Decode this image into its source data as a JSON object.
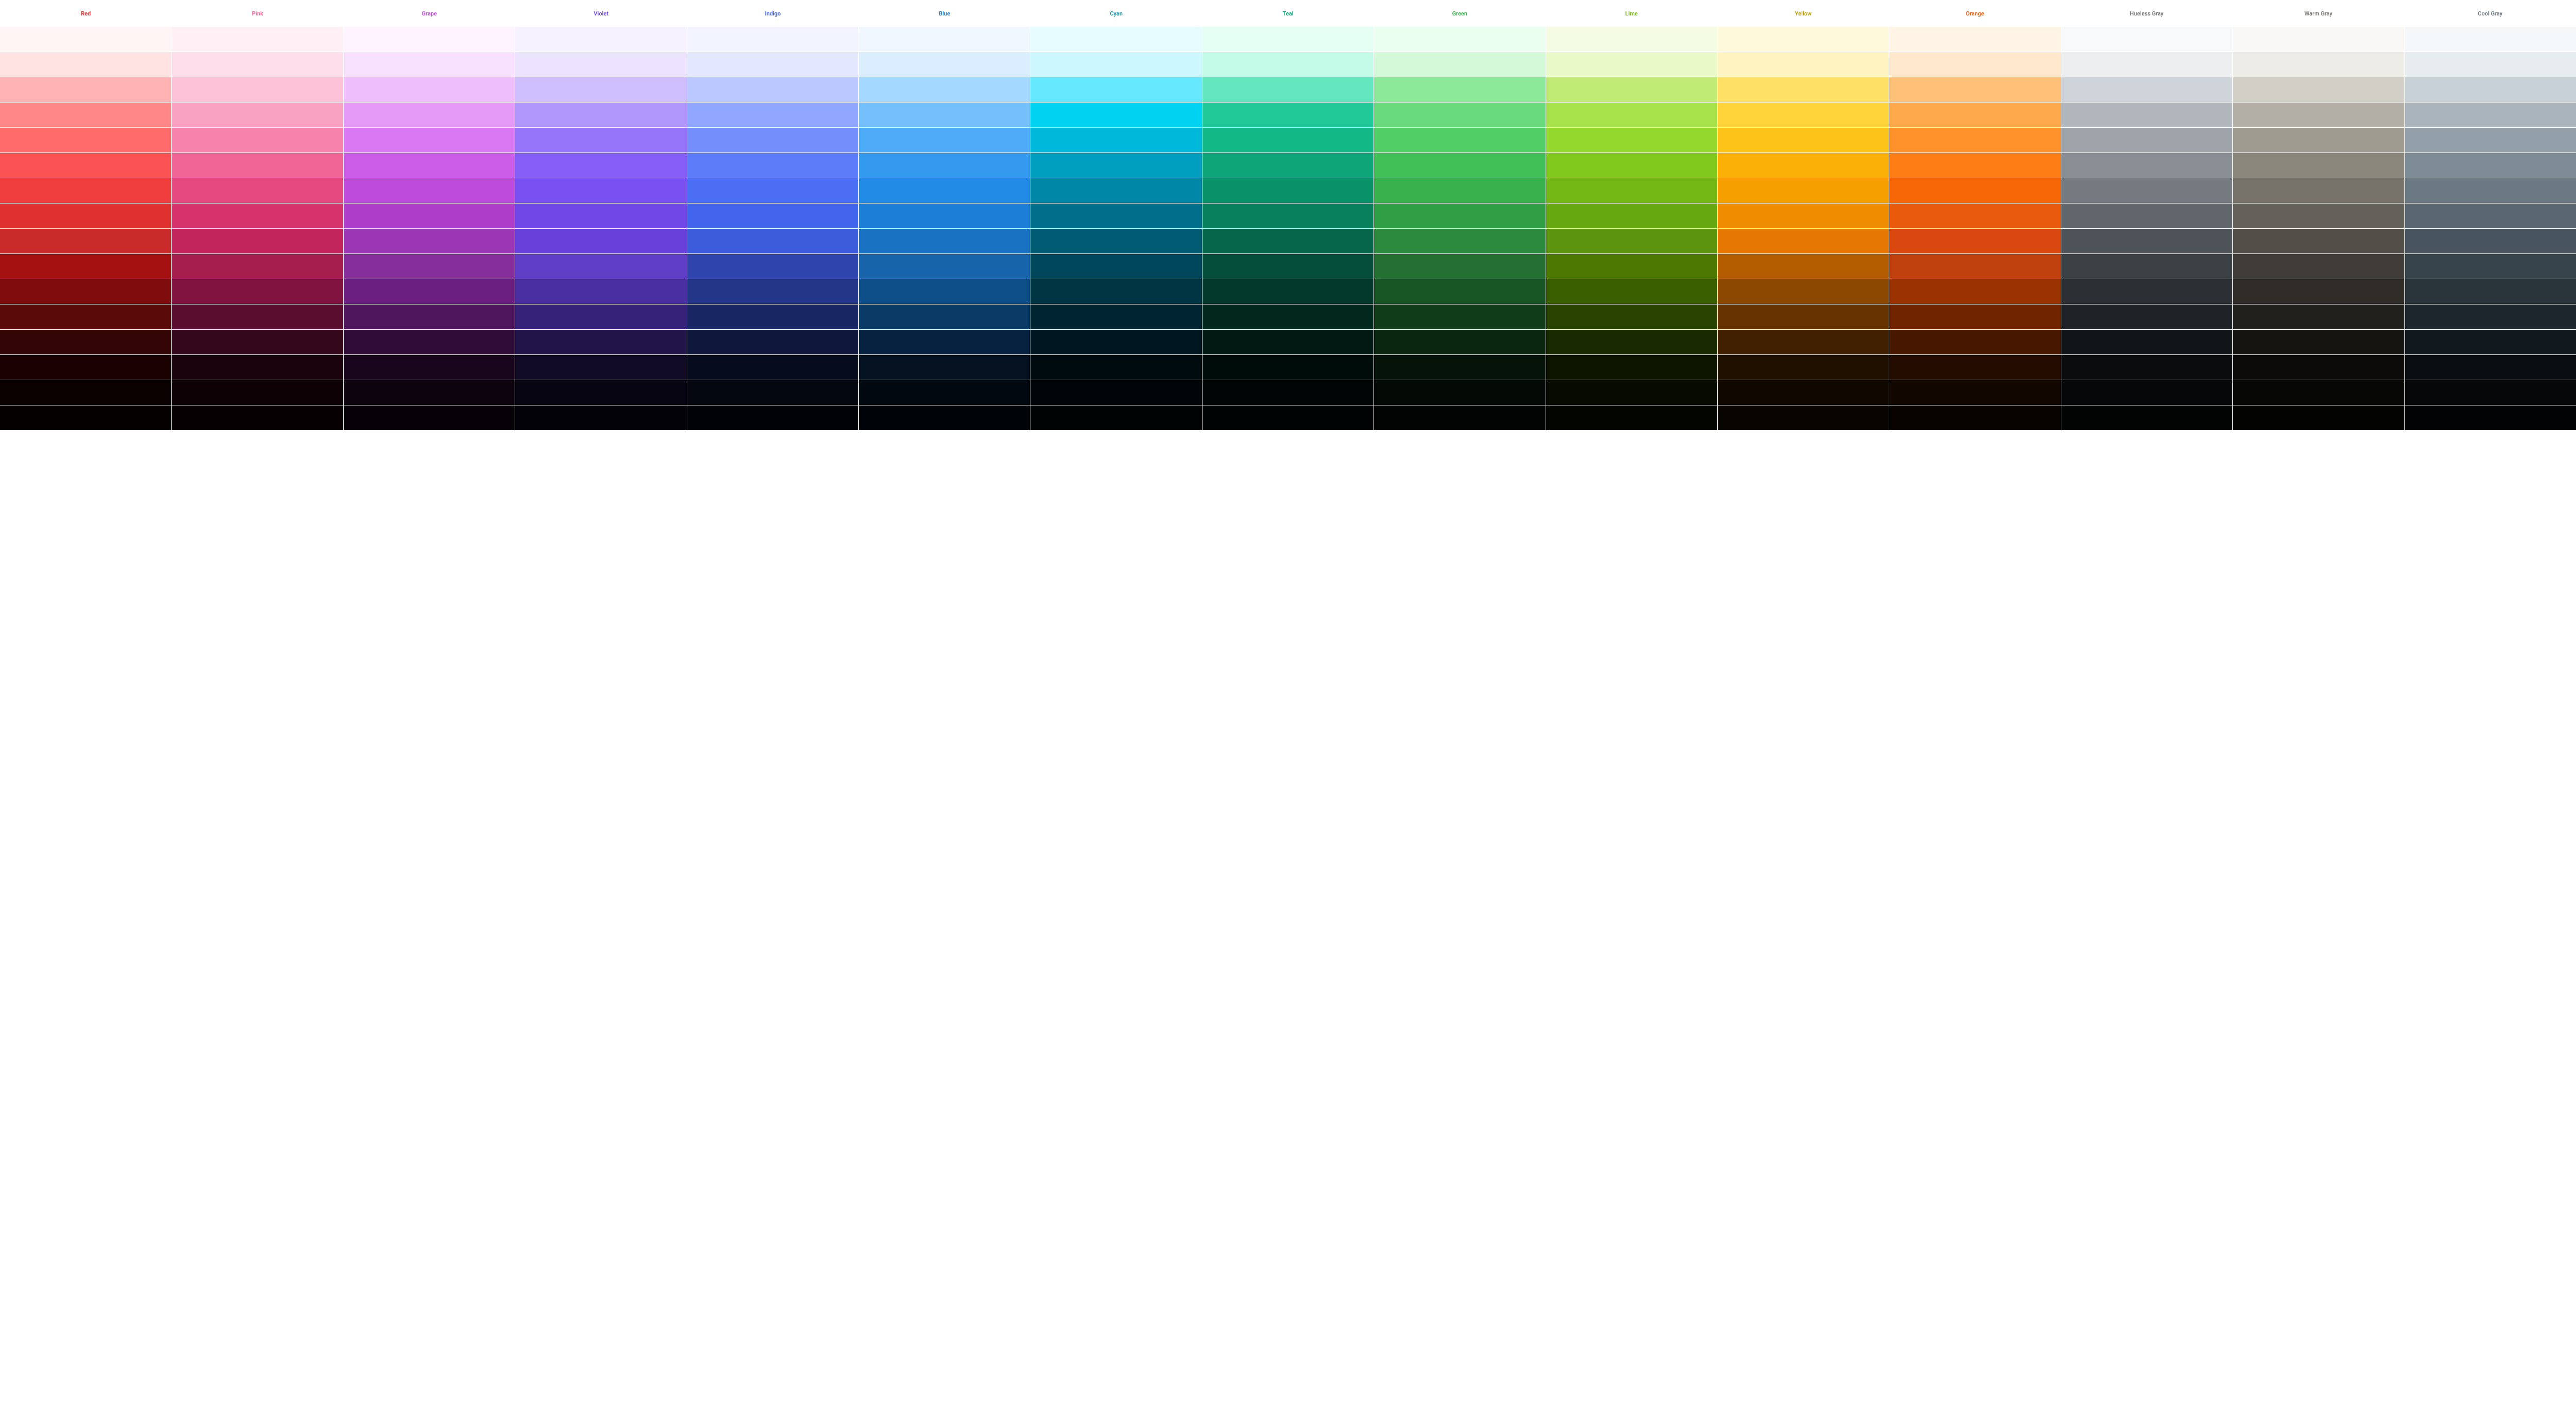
{
  "palette": {
    "columns": [
      {
        "name": "Red",
        "labelColor": "#e03131"
      },
      {
        "name": "Pink",
        "labelColor": "#f06595"
      },
      {
        "name": "Grape",
        "labelColor": "#be4bdb"
      },
      {
        "name": "Violet",
        "labelColor": "#7048e8"
      },
      {
        "name": "Indigo",
        "labelColor": "#4263eb"
      },
      {
        "name": "Blue",
        "labelColor": "#1c7ed6"
      },
      {
        "name": "Cyan",
        "labelColor": "#1098ad"
      },
      {
        "name": "Teal",
        "labelColor": "#0ca678"
      },
      {
        "name": "Green",
        "labelColor": "#37b24d"
      },
      {
        "name": "Lime",
        "labelColor": "#74b816"
      },
      {
        "name": "Yellow",
        "labelColor": "#c29c00"
      },
      {
        "name": "Orange",
        "labelColor": "#e8590c"
      },
      {
        "name": "Hueless Gray",
        "labelColor": "#777777"
      },
      {
        "name": "Warm Gray",
        "labelColor": "#7a7770"
      },
      {
        "name": "Cool Gray",
        "labelColor": "#6f7a82"
      }
    ],
    "shades": [
      [
        "#fff5f5",
        "#fff0f6",
        "#fdf4ff",
        "#f7f2ff",
        "#f2f4ff",
        "#f0f7ff",
        "#e6fcff",
        "#e6fff5",
        "#ebfff0",
        "#f4fce3",
        "#fff9db",
        "#fff4e6",
        "#f8f9fa",
        "#f9f8f6",
        "#f5f8fa"
      ],
      [
        "#ffe3e3",
        "#ffdeeb",
        "#f8e1ff",
        "#ece4ff",
        "#e4e8ff",
        "#dbeeff",
        "#ccf7ff",
        "#c3fae8",
        "#d3f9d8",
        "#e9fac8",
        "#fff3bf",
        "#ffe8cc",
        "#eceeef",
        "#eeece7",
        "#e7ecef"
      ],
      [
        "#ffb3b3",
        "#fcc2d7",
        "#eebefa",
        "#d0bfff",
        "#bac8ff",
        "#a5d8ff",
        "#66e8ff",
        "#63e6be",
        "#8ce99a",
        "#c0eb75",
        "#ffe066",
        "#ffc078",
        "#ced4da",
        "#d2cfc7",
        "#c8d1d8"
      ],
      [
        "#ff8787",
        "#faa2c1",
        "#e599f7",
        "#b197fc",
        "#91a7ff",
        "#74c0fc",
        "#00d3f2",
        "#20c997",
        "#69db7c",
        "#a9e34b",
        "#ffd43b",
        "#ffa94d",
        "#b0b6bb",
        "#b3afa6",
        "#a9b4bc"
      ],
      [
        "#ff6b6b",
        "#f783ac",
        "#da77f2",
        "#9775fa",
        "#748ffc",
        "#4dabf7",
        "#00b8d9",
        "#12b886",
        "#51cf66",
        "#94d82d",
        "#fcc419",
        "#ff922b",
        "#9ea4a9",
        "#9f9b91",
        "#93a0a9"
      ],
      [
        "#fa5252",
        "#f06595",
        "#cc5de8",
        "#845ef7",
        "#5c7cfa",
        "#339af0",
        "#009ebf",
        "#0ca678",
        "#40c057",
        "#82c91e",
        "#fab005",
        "#fd7e14",
        "#888e94",
        "#8b877d",
        "#7e8c96"
      ],
      [
        "#f03e3e",
        "#e64980",
        "#be4bdb",
        "#7950f2",
        "#4c6ef5",
        "#228be6",
        "#0086a6",
        "#099268",
        "#37b24d",
        "#74b816",
        "#f59f00",
        "#f76707",
        "#747a80",
        "#77736a",
        "#6b7983"
      ],
      [
        "#e03131",
        "#d6336c",
        "#ae3ec9",
        "#7048e8",
        "#4263eb",
        "#1c7ed6",
        "#006f8c",
        "#087f5b",
        "#2f9e44",
        "#66a80f",
        "#f08c00",
        "#e8590c",
        "#61666c",
        "#64605a",
        "#596770"
      ],
      [
        "#c92a2a",
        "#c2255c",
        "#9c36b5",
        "#6741d9",
        "#3b5bdb",
        "#1971c2",
        "#005b73",
        "#066649",
        "#2b8a3e",
        "#5c940d",
        "#e67700",
        "#d9480f",
        "#4e5359",
        "#514e48",
        "#48555e"
      ],
      [
        "#a51111",
        "#a61e4d",
        "#862e9c",
        "#5f3dc4",
        "#2f44ad",
        "#1864ab",
        "#00475b",
        "#044e3a",
        "#237032",
        "#4c7a00",
        "#b35c00",
        "#bf400d",
        "#3c4146",
        "#403d38",
        "#38444c"
      ],
      [
        "#800d0d",
        "#801340",
        "#6b1f80",
        "#4a2fa0",
        "#233688",
        "#0e4f8a",
        "#003544",
        "#03392b",
        "#195626",
        "#3a5f00",
        "#8c4700",
        "#9a3300",
        "#2c3035",
        "#302d29",
        "#2a343b"
      ],
      [
        "#5a0909",
        "#5a0d2e",
        "#4f165e",
        "#362278",
        "#182663",
        "#0a3a66",
        "#002430",
        "#02281e",
        "#113c1a",
        "#294300",
        "#663300",
        "#702500",
        "#1e2226",
        "#21201c",
        "#1d262c"
      ],
      [
        "#330505",
        "#35071b",
        "#2f0d38",
        "#201448",
        "#0e163b",
        "#062240",
        "#001620",
        "#011813",
        "#0a2510",
        "#192900",
        "#402000",
        "#471700",
        "#121518",
        "#151411",
        "#12191e"
      ],
      [
        "#1a0202",
        "#1b030d",
        "#18061c",
        "#100a24",
        "#070b1e",
        "#031120",
        "#000b10",
        "#000c09",
        "#051308",
        "#0c1400",
        "#201000",
        "#240c00",
        "#0a0c0e",
        "#0c0b09",
        "#0a0e11"
      ],
      [
        "#0c0101",
        "#0d0106",
        "#0c030e",
        "#080512",
        "#03050f",
        "#010810",
        "#000608",
        "#000605",
        "#020904",
        "#060a00",
        "#100800",
        "#120600",
        "#050607",
        "#060605",
        "#050708"
      ],
      [
        "#050000",
        "#060003",
        "#060107",
        "#040209",
        "#010208",
        "#000408",
        "#000304",
        "#000303",
        "#010402",
        "#030500",
        "#080400",
        "#090300",
        "#020303",
        "#030302",
        "#020304"
      ]
    ]
  }
}
